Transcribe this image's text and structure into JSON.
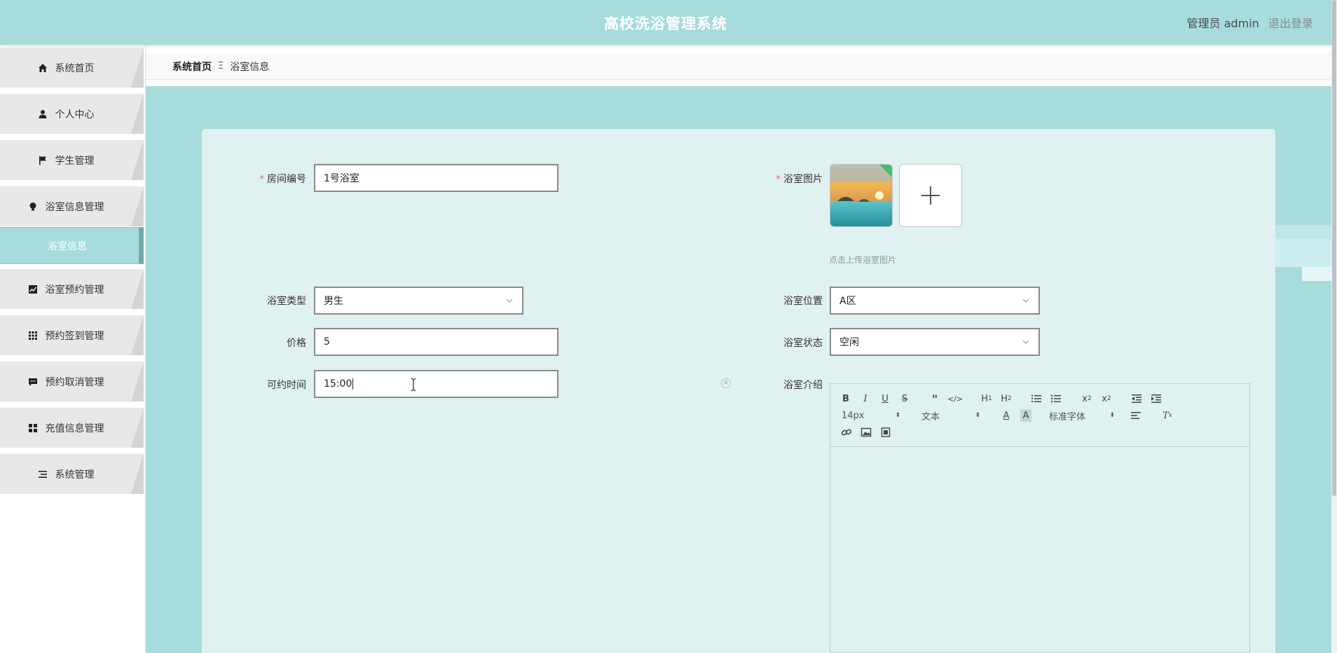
{
  "header": {
    "title": "高校洗浴管理系统",
    "user_label": "管理员 admin",
    "logout_label": "退出登录"
  },
  "sidebar": {
    "items": [
      {
        "label": "系统首页",
        "icon": "home-icon"
      },
      {
        "label": "个人中心",
        "icon": "user-icon"
      },
      {
        "label": "学生管理",
        "icon": "flag-icon"
      },
      {
        "label": "浴室信息管理",
        "icon": "bulb-icon"
      },
      {
        "label": "浴室预约管理",
        "icon": "chart-icon"
      },
      {
        "label": "预约签到管理",
        "icon": "grid-icon"
      },
      {
        "label": "预约取消管理",
        "icon": "chat-icon"
      },
      {
        "label": "充值信息管理",
        "icon": "apps-icon"
      },
      {
        "label": "系统管理",
        "icon": "list-icon"
      }
    ],
    "submenu_active": "浴室信息"
  },
  "breadcrumb": {
    "home": "系统首页",
    "separator": "Ξ",
    "current": "浴室信息"
  },
  "form": {
    "room_no": {
      "label": "房间编号",
      "value": "1号浴室",
      "required": true
    },
    "image": {
      "label": "浴室图片",
      "tip": "点击上传浴室图片",
      "required": true
    },
    "type": {
      "label": "浴室类型",
      "value": "男生"
    },
    "location": {
      "label": "浴室位置",
      "value": "A区"
    },
    "price": {
      "label": "价格",
      "value": "5"
    },
    "status": {
      "label": "浴室状态",
      "value": "空闲"
    },
    "time": {
      "label": "可约时间",
      "value": "15:00"
    },
    "intro": {
      "label": "浴室介绍"
    }
  },
  "editor": {
    "font_size": "14px",
    "paragraph": "文本",
    "font_family": "标准字体"
  },
  "colors": {
    "theme": "#a7dcdc",
    "card": "#dff1f0",
    "required": "#f56c6c"
  }
}
